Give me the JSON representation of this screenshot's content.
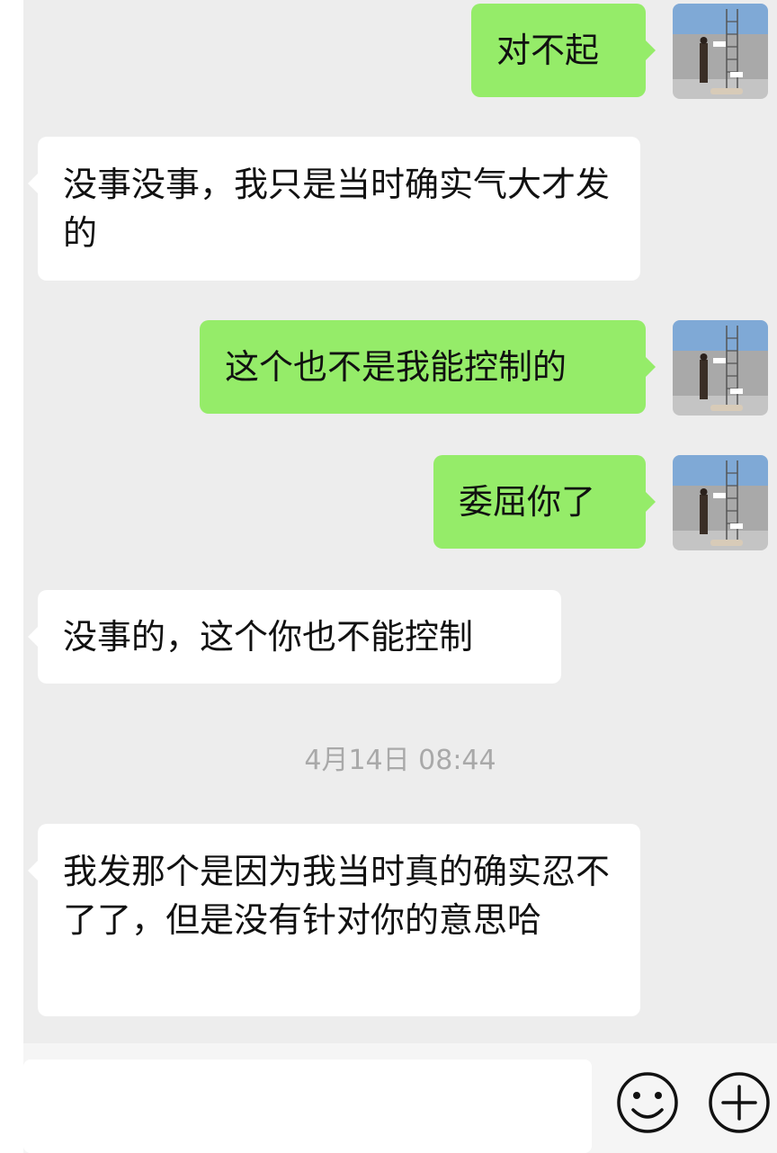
{
  "conversation": {
    "messages": [
      {
        "direction": "out",
        "text": "对不起",
        "avatar": "avatar-scene"
      },
      {
        "direction": "in",
        "text": "没事没事，我只是当时确实气大才发的"
      },
      {
        "direction": "out",
        "text": "这个也不是我能控制的",
        "avatar": "avatar-scene"
      },
      {
        "direction": "out",
        "text": "委屈你了",
        "avatar": "avatar-scene"
      },
      {
        "direction": "in",
        "text": "没事的，这个你也不能控制"
      },
      {
        "direction": "in",
        "text": "我发那个是因为我当时真的确实忍不了了，但是没有针对你的意思哈"
      }
    ],
    "timestamp": "4月14日 08:44"
  },
  "input_bar": {
    "value": "",
    "emoji_icon": "emoji-smile-icon",
    "more_icon": "plus-circle-icon"
  },
  "colors": {
    "outgoing_bubble": "#95ec69",
    "incoming_bubble": "#ffffff",
    "chat_background": "#ededed",
    "timestamp_text": "#a9a9a9"
  }
}
